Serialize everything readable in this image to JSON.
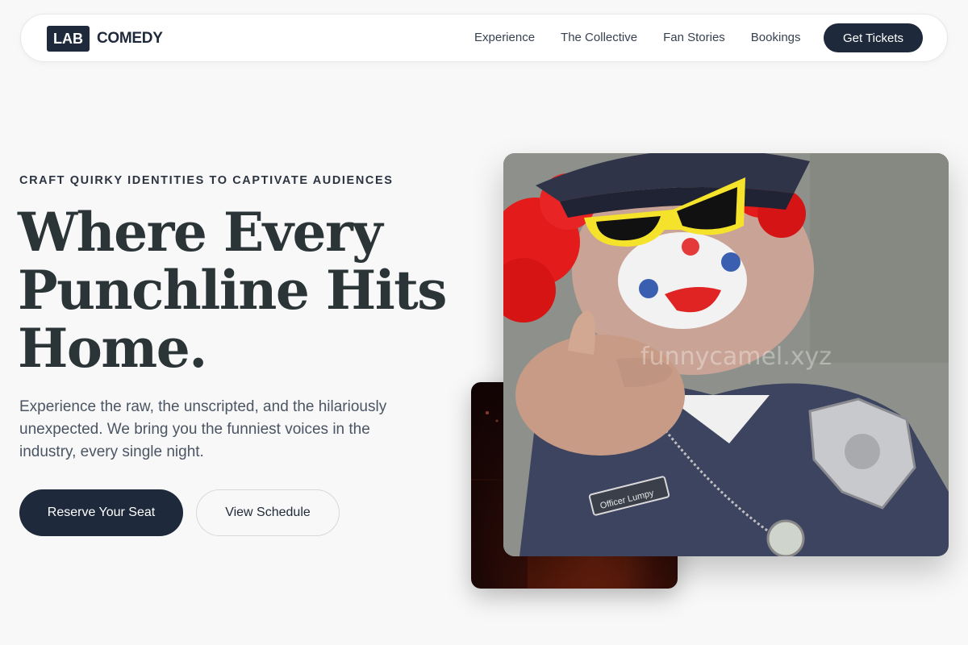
{
  "nav": {
    "logo_box": "LAB",
    "logo_text": "COMEDY",
    "links": [
      "Experience",
      "The Collective",
      "Fan Stories",
      "Bookings"
    ],
    "cta": "Get Tickets"
  },
  "hero": {
    "eyebrow": "CRAFT QUIRKY IDENTITIES TO CAPTIVATE AUDIENCES",
    "headline": "Where Every Punchline Hits Home.",
    "subtext": "Experience the raw, the unscripted, and the hilariously unexpected. We bring you the funniest voices in the industry, every single night.",
    "primary_button": "Reserve Your Seat",
    "secondary_button": "View Schedule"
  },
  "photo": {
    "watermark": "funnycamel.xyz",
    "name_tag": "Officer Lumpy"
  },
  "colors": {
    "accent": "#1e293b",
    "background": "#f8f8f8"
  }
}
